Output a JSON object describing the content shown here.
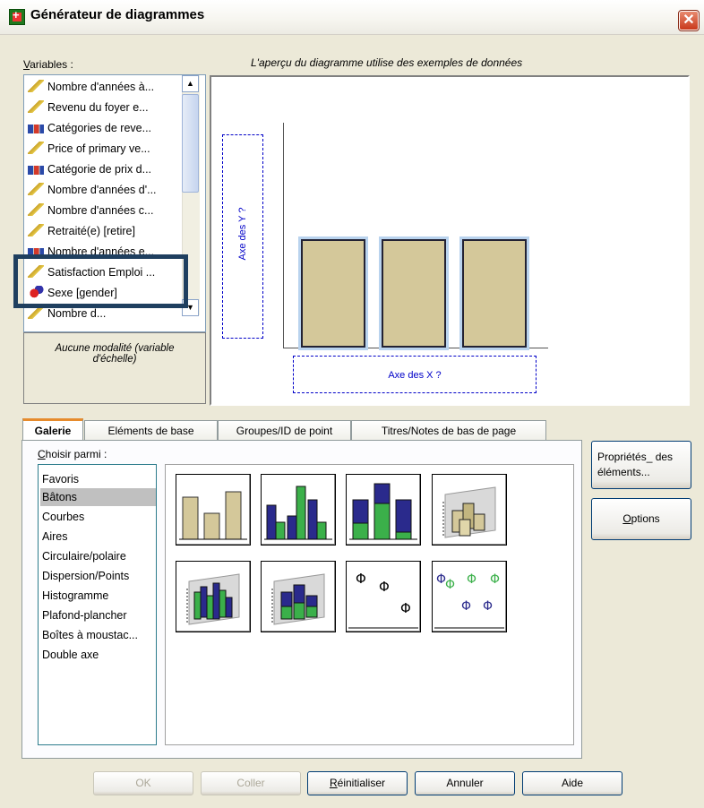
{
  "window": {
    "title": "Générateur de diagrammes",
    "close_glyph": "✕"
  },
  "variables": {
    "label_prefix": "V",
    "label_rest": "ariables :",
    "items": [
      {
        "label": "Nombre d'années à...",
        "icon": "scale-ruler-icon"
      },
      {
        "label": "Revenu du foyer e...",
        "icon": "scale-ruler-icon"
      },
      {
        "label": "Catégories de reve...",
        "icon": "ordinal-bars-icon"
      },
      {
        "label": "Price of primary ve...",
        "icon": "scale-ruler-icon"
      },
      {
        "label": "Catégorie de prix d...",
        "icon": "ordinal-bars-icon"
      },
      {
        "label": "Nombre d'années d'...",
        "icon": "scale-ruler-icon"
      },
      {
        "label": "Nombre d'années c...",
        "icon": "scale-ruler-icon"
      },
      {
        "label": "Retraité(e) [retire]",
        "icon": "scale-ruler-icon"
      },
      {
        "label": "Nombre d'années e...",
        "icon": "ordinal-bars-icon"
      },
      {
        "label": "Satisfaction Emploi ...",
        "icon": "scale-ruler-icon"
      },
      {
        "label": "Sexe [gender]",
        "icon": "nominal-icon"
      },
      {
        "label": "Nombre d...",
        "icon": "scale-ruler-icon"
      }
    ],
    "category_note": "Aucune modalité (variable d'échelle)"
  },
  "preview": {
    "caption": "L'aperçu du diagramme utilise des exemples de données",
    "y_axis": "Axe des Y ?",
    "x_axis": "Axe des X ?"
  },
  "tabs": [
    {
      "label": "Galerie",
      "active": true
    },
    {
      "label": "Eléments de base",
      "active": false
    },
    {
      "label": "Groupes/ID de point",
      "active": false
    },
    {
      "label": "Titres/Notes de bas de page",
      "active": false
    }
  ],
  "gallery": {
    "choose_prefix": "C",
    "choose_rest": "hoisir parmi :",
    "types": [
      "Favoris",
      "Bâtons",
      "Courbes",
      "Aires",
      "Circulaire/polaire",
      "Dispersion/Points",
      "Histogramme",
      "Plafond-plancher",
      "Boîtes à moustac...",
      "Double axe"
    ],
    "selected": "Bâtons",
    "thumbnails": [
      "simple-bar-chart-icon",
      "clustered-bar-chart-icon",
      "stacked-bar-chart-icon",
      "3d-bar-chart-icon",
      "3d-clustered-bar-chart-icon",
      "3d-stacked-bar-chart-icon",
      "error-bar-chart-icon",
      "clustered-error-bar-chart-icon"
    ]
  },
  "side_buttons": {
    "element_properties": "Propriétés_ des éléments...",
    "options_prefix": "O",
    "options_rest": "ptions"
  },
  "footer": {
    "ok": "OK",
    "paste": "Coller",
    "reset_prefix": "R",
    "reset_rest": "éinitialiser",
    "cancel": "Annuler",
    "help": "Aide"
  },
  "colors": {
    "bar_fill": "#d4c89a",
    "blue": "#2a2a8c",
    "green": "#3bb04a",
    "axis_dash": "#0000c8",
    "tab_accent": "#e68b2c"
  }
}
